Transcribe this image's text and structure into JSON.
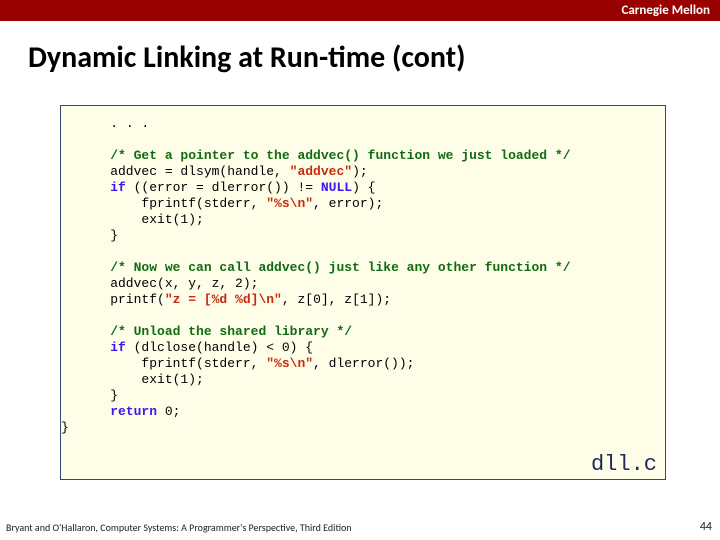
{
  "banner": {
    "label": "Carnegie Mellon"
  },
  "slide": {
    "title": "Dynamic Linking at Run-time (cont)"
  },
  "code": {
    "l01": ". . .",
    "c1": "/* Get a pointer to the addvec() function we just loaded */",
    "l03a": "    addvec = dlsym(handle, ",
    "l03s": "\"addvec\"",
    "l03b": ");",
    "l04a": "    ",
    "l04k": "if",
    "l04b": " ((error = dlerror()) != ",
    "l04n": "NULL",
    "l04c": ") {",
    "l05a": "        fprintf(stderr, ",
    "l05s": "\"%s\\n\"",
    "l05b": ", error);",
    "l06": "        exit(1);",
    "l07": "    }",
    "c2": "/* Now we can call addvec() just like any other function */",
    "l09": "    addvec(x, y, z, 2);",
    "l10a": "    printf(",
    "l10s": "\"z = [%d %d]\\n\"",
    "l10b": ", z[0], z[1]);",
    "c3": "/* Unload the shared library */",
    "l12a": "    ",
    "l12k": "if",
    "l12b": " (dlclose(handle) < 0) {",
    "l13a": "        fprintf(stderr, ",
    "l13s": "\"%s\\n\"",
    "l13b": ", dlerror());",
    "l14": "        exit(1);",
    "l15": "    }",
    "l16a": "    ",
    "l16k": "return",
    "l16b": " 0;",
    "l17": "}",
    "filelabel": "dll.c"
  },
  "footer": {
    "credit": "Bryant and O'Hallaron, Computer Systems: A Programmer's Perspective, Third Edition",
    "pagenum": "44"
  }
}
